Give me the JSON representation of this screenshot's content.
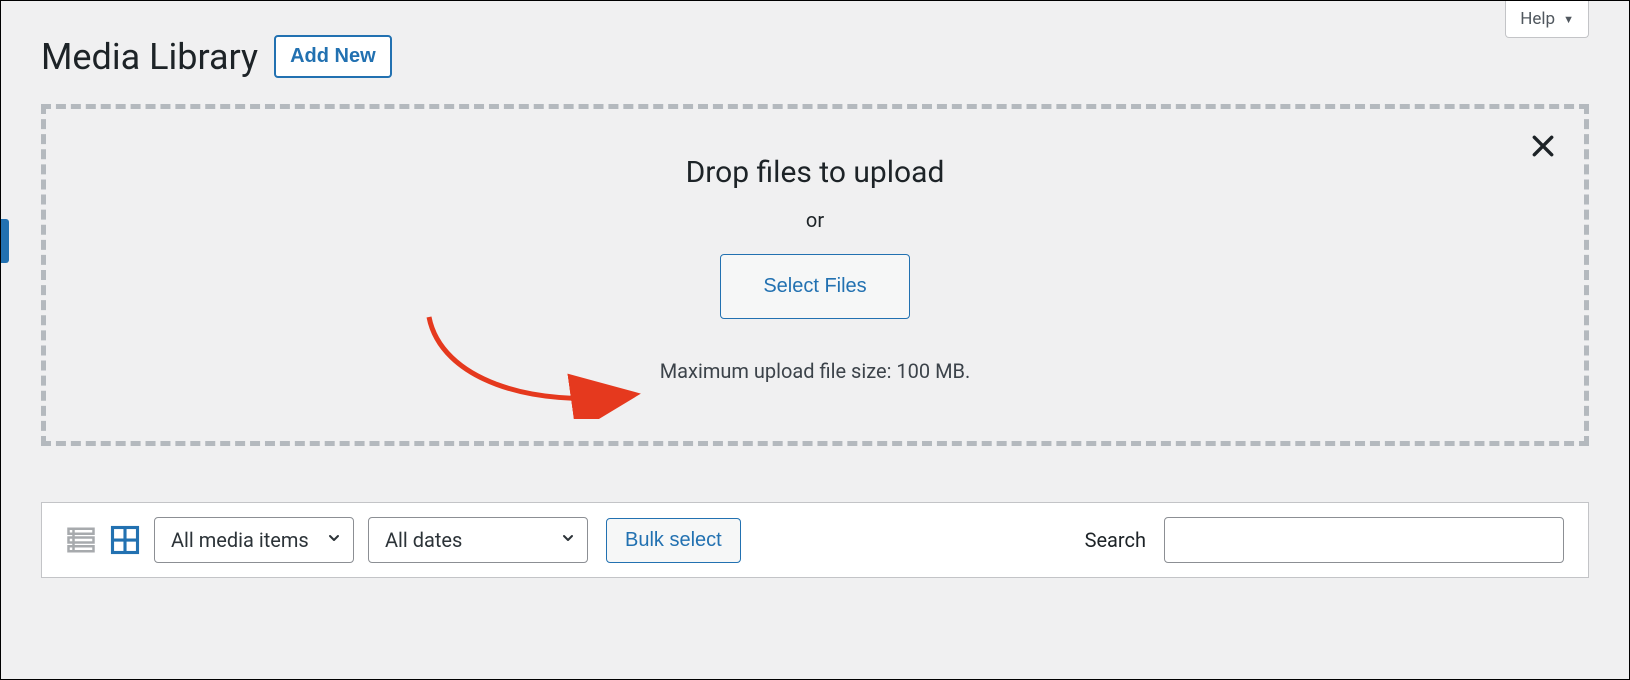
{
  "help": {
    "label": "Help"
  },
  "header": {
    "title": "Media Library",
    "add_new_label": "Add New"
  },
  "upload": {
    "heading": "Drop files to upload",
    "or": "or",
    "select_files_label": "Select Files",
    "max_size_text": "Maximum upload file size: 100 MB."
  },
  "toolbar": {
    "filter_media": {
      "selected": "All media items",
      "options": [
        "All media items"
      ]
    },
    "filter_dates": {
      "selected": "All dates",
      "options": [
        "All dates"
      ]
    },
    "bulk_select_label": "Bulk select",
    "search_label": "Search",
    "search_value": ""
  },
  "colors": {
    "accent": "#2271b1",
    "annotation": "#e5391e"
  }
}
